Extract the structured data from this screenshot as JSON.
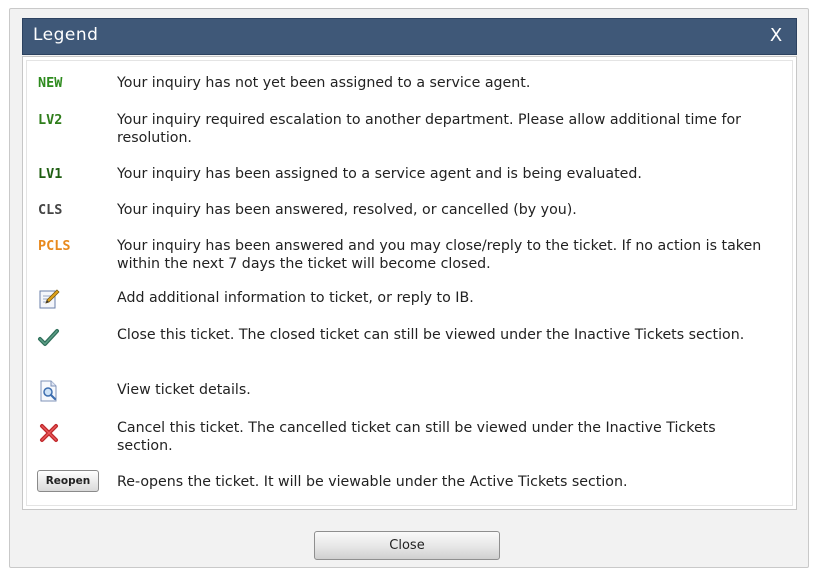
{
  "dialog": {
    "title": "Legend",
    "close_glyph": "X",
    "footer_close_label": "Close"
  },
  "colors": {
    "titlebar": "#3f5878",
    "status_new": "#2e8b1e",
    "status_lv2": "#2e7d1a",
    "status_lv1": "#1f5e12",
    "status_cls": "#444444",
    "status_pcls": "#e8891d"
  },
  "legend": {
    "statuses": [
      {
        "code": "NEW",
        "desc": "Your inquiry has not yet been assigned to a service agent."
      },
      {
        "code": "LV2",
        "desc": "Your inquiry required escalation to another department. Please allow additional time for resolution."
      },
      {
        "code": "LV1",
        "desc": "Your inquiry has been assigned to a service agent and is being evaluated."
      },
      {
        "code": "CLS",
        "desc": "Your inquiry has been answered, resolved, or cancelled (by you)."
      },
      {
        "code": "PCLS",
        "desc": "Your inquiry has been answered and you may close/reply to the ticket. If no action is taken within the next 7 days the ticket will become closed."
      }
    ],
    "actions": [
      {
        "icon": "edit-note-icon",
        "desc": "Add additional information to ticket, or reply to IB."
      },
      {
        "icon": "checkmark-icon",
        "desc": "Close this ticket. The closed ticket can still be viewed under the Inactive Tickets section."
      },
      {
        "icon": "view-document-icon",
        "desc": "View ticket details."
      },
      {
        "icon": "red-x-icon",
        "desc": "Cancel this ticket. The cancelled ticket can still be viewed under the Inactive Tickets section."
      },
      {
        "icon": "reopen-button",
        "button_label": "Reopen",
        "desc": "Re-opens the ticket. It will be viewable under the Active Tickets section."
      }
    ]
  }
}
